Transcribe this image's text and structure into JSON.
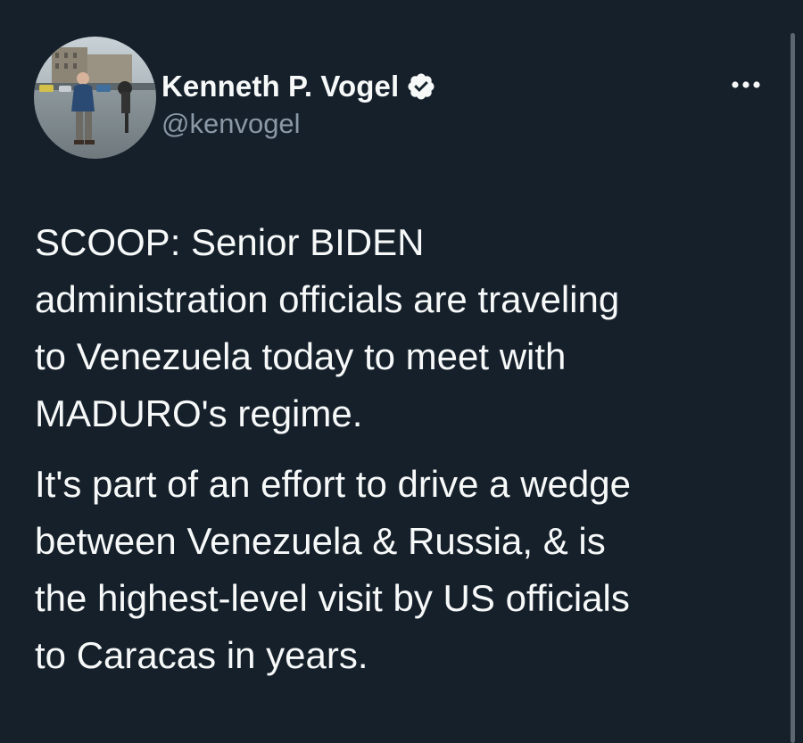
{
  "author": {
    "display_name": "Kenneth P. Vogel",
    "handle": "@kenvogel",
    "verified": true,
    "avatar_icon": "profile-photo"
  },
  "actions": {
    "more_icon": "more-horizontal-icon"
  },
  "tweet": {
    "paragraphs": [
      "SCOOP: Senior BIDEN\nadministration officials are traveling\nto Venezuela today to meet with\nMADURO's regime.",
      "It's part of an effort to drive a wedge\nbetween Venezuela & Russia, & is\nthe highest-level visit by US officials\nto Caracas in years."
    ]
  },
  "colors": {
    "background": "#15202b",
    "text_primary": "#f7f9f9",
    "text_secondary": "#8b98a5",
    "verified_badge": "#f7f9f9",
    "scrollbar": "#5b6670"
  }
}
